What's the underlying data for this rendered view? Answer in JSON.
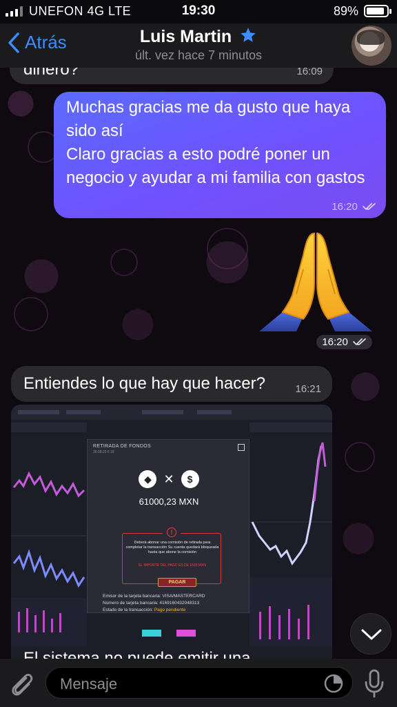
{
  "status_bar": {
    "carrier": "UNEFON 4G  LTE",
    "time": "19:30",
    "battery_percent_label": "89%",
    "battery_level": 0.89
  },
  "header": {
    "back_label": "Atrás",
    "contact_name": "Luis Martin",
    "last_seen": "últ. vez hace 7 minutos"
  },
  "messages": [
    {
      "direction": "in",
      "text": "dinero?",
      "time": "16:09"
    },
    {
      "direction": "out",
      "text": "Muchas gracias me da gusto que haya sido así\nClaro gracias a esto podré poner un negocio y ayudar a mi familia con gastos",
      "time": "16:20"
    },
    {
      "direction": "out",
      "type": "emoji",
      "emoji": "🙏",
      "time": "16:20"
    },
    {
      "direction": "in",
      "text": "Entiendes lo que hay que hacer?",
      "time": "16:21"
    }
  ],
  "photo": {
    "modal_title": "RETIRADA DE FONDOS",
    "modal_date": "30.08.23 II 19",
    "amount": "61000,23 MXN",
    "warning": "Deberá abonar una comisión de retirada para completar la transacción Su cuenta quedará bloqueada hasta que abone la comisión",
    "warning_red": "EL IMPORTE DEL PAGO ES DE 1500 MXN",
    "pay_button": "PAGAR",
    "issuer_label": "Emisor de la tarjeta bancaria:",
    "issuer_value": "VISA/MASTERCARD",
    "card_label": "Número de tarjeta bancaria:",
    "card_value": "4169160432048313",
    "status_label": "Estado de la transacción:",
    "status_value": "Pago pendiente"
  },
  "cut_message": "El sistema no puede emitir una",
  "input": {
    "placeholder": "Mensaje"
  },
  "colors": {
    "accent": "#3a8eff",
    "outgoing_bubble": "#6a5cff",
    "incoming_bubble": "#2a2a2c"
  },
  "icons": [
    "back-chevron-icon",
    "star-icon",
    "double-check-icon",
    "chevron-down-icon",
    "attach-icon",
    "sticker-icon",
    "mic-icon"
  ]
}
